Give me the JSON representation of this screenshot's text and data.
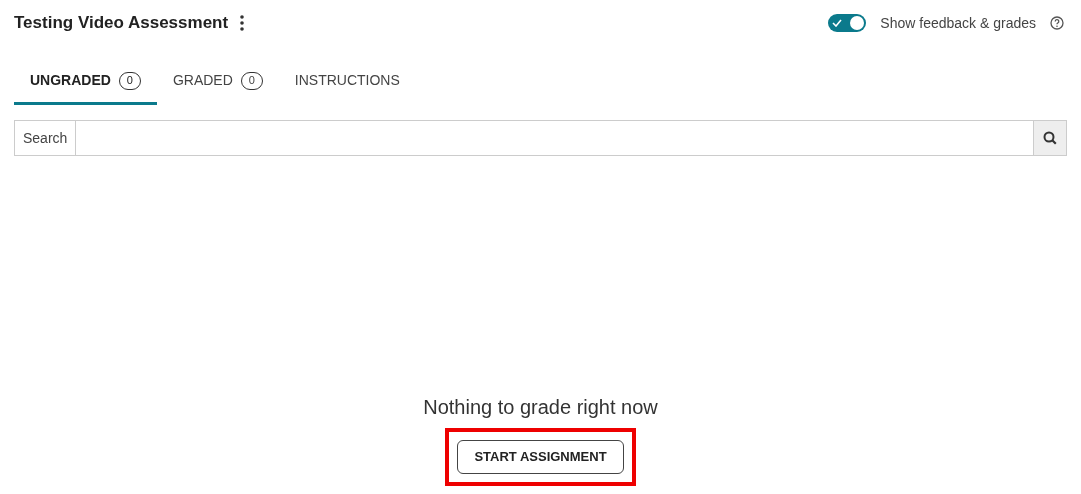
{
  "header": {
    "title": "Testing Video Assessment",
    "toggle": {
      "label": "Show feedback & grades",
      "on": true
    }
  },
  "tabs": [
    {
      "label": "UNGRADED",
      "count": "0",
      "selected": true
    },
    {
      "label": "GRADED",
      "count": "0",
      "selected": false
    },
    {
      "label": "INSTRUCTIONS",
      "selected": false
    }
  ],
  "search": {
    "label": "Search"
  },
  "empty_state": {
    "message": "Nothing to grade right now",
    "button": {
      "label": "START ASSIGNMENT",
      "highlighted": true
    }
  }
}
